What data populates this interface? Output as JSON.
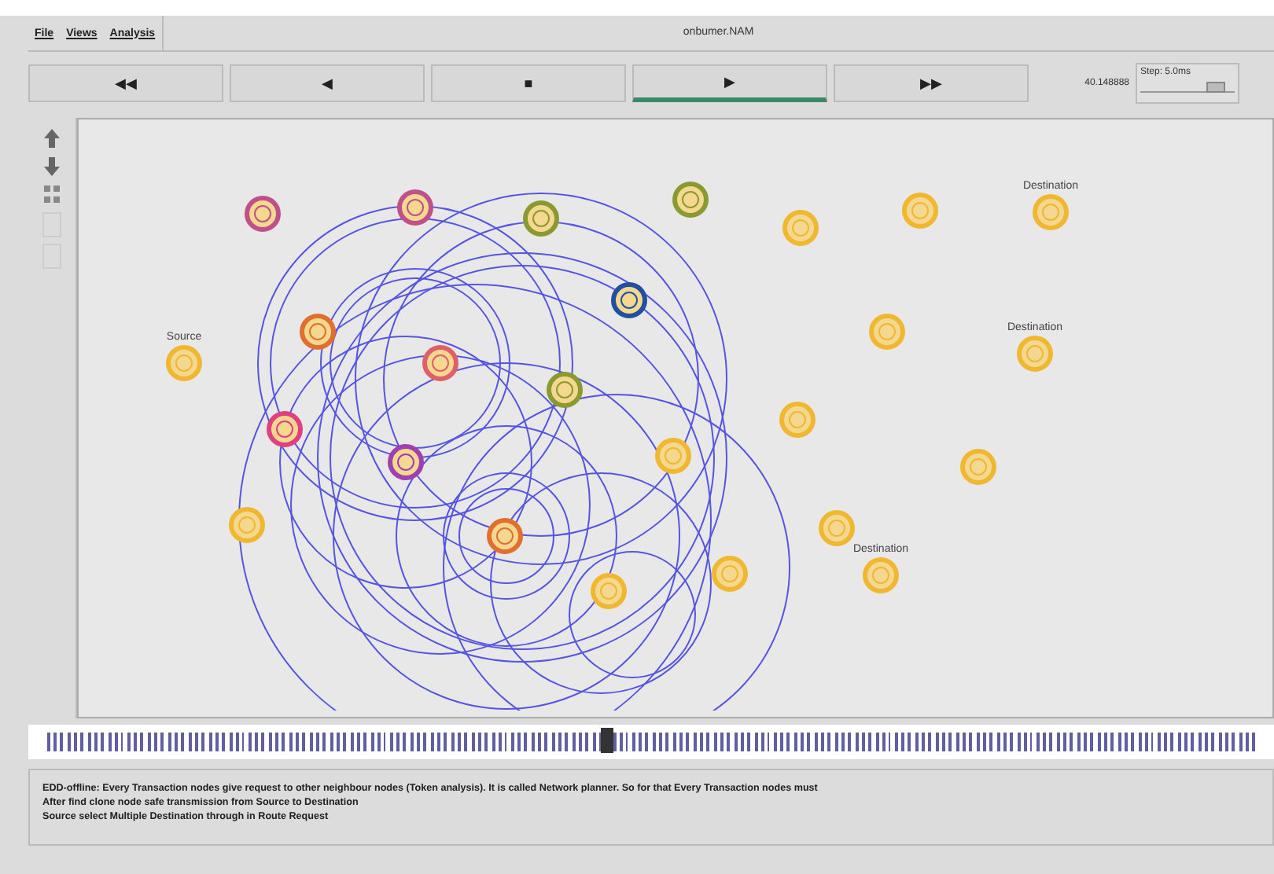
{
  "menu": [
    "File",
    "Views",
    "Analysis"
  ],
  "window": {
    "title": "onbumer.NAM"
  },
  "controls": [
    {
      "glyph": "◀◀",
      "selected": false
    },
    {
      "glyph": "◀",
      "selected": false
    },
    {
      "glyph": "■",
      "selected": false
    },
    {
      "glyph": "▶",
      "selected": true
    },
    {
      "glyph": "▶▶",
      "selected": false
    }
  ],
  "time": "40.148888",
  "step": {
    "label": "Step: 5.0ms"
  },
  "nodes": [
    {
      "color": "#c0508a"
    },
    {
      "color": "#c0508a"
    },
    {
      "color": "#8a9a30"
    },
    {
      "color": "#8a9a30"
    },
    {
      "color": "#f0b830"
    },
    {
      "color": "#f0b830"
    },
    {
      "color": "#f0b830",
      "label": "Destination"
    },
    {
      "color": "#f0b830",
      "label": "Source"
    },
    {
      "color": "#e07030"
    },
    {
      "color": "#e0606a"
    },
    {
      "color": "#2050a0"
    },
    {
      "color": "#8a9a30"
    },
    {
      "color": "#f0b830"
    },
    {
      "color": "#f0b830",
      "label": "Destination"
    },
    {
      "color": "#e04080"
    },
    {
      "color": "#a040b0"
    },
    {
      "color": "#f0b830"
    },
    {
      "color": "#f0b830"
    },
    {
      "color": "#f0b830"
    },
    {
      "color": "#f0b830"
    },
    {
      "color": "#e07030"
    },
    {
      "color": "#f0b830"
    },
    {
      "color": "#f0b830",
      "label": "Destination"
    },
    {
      "color": "#f0b830"
    },
    {
      "color": "#f0b830"
    }
  ],
  "timeline": {
    "level": 0.46
  },
  "messages": [
    "EDD-offline: Every Transaction nodes give request to other neighbour nodes (Token analysis). It is called Network planner. So for that Every Transaction nodes must",
    "After find clone node safe transmission from Source to Destination",
    "Source select Multiple Destination through in Route Request"
  ]
}
